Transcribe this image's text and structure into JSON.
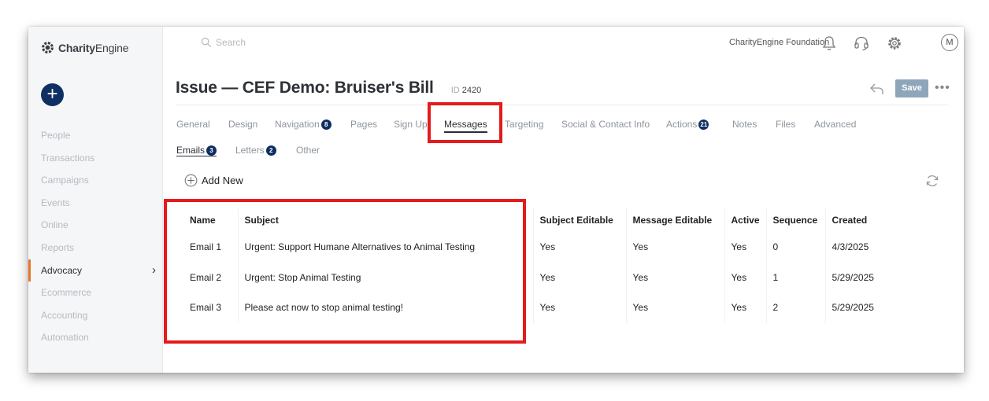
{
  "app": {
    "logo_bold": "Charity",
    "logo_rest": "Engine"
  },
  "sidebar": {
    "add_label": "+",
    "items": [
      {
        "label": "People"
      },
      {
        "label": "Transactions"
      },
      {
        "label": "Campaigns"
      },
      {
        "label": "Events"
      },
      {
        "label": "Online"
      },
      {
        "label": "Reports"
      },
      {
        "label": "Advocacy",
        "active": true
      },
      {
        "label": "Ecommerce"
      },
      {
        "label": "Accounting"
      },
      {
        "label": "Automation"
      }
    ],
    "chevron": "›"
  },
  "topbar": {
    "search_placeholder": "Search",
    "org_name": "CharityEngine Foundation",
    "avatar_initial": "M"
  },
  "page": {
    "title": "Issue — CEF Demo: Bruiser's Bill",
    "id_label": "ID",
    "id_value": "2420",
    "save_label": "Save",
    "more_label": "•••"
  },
  "tabs": [
    {
      "label": "General"
    },
    {
      "label": "Design"
    },
    {
      "label": "Navigation",
      "badge": "8"
    },
    {
      "label": "Pages"
    },
    {
      "label": "Sign Up"
    },
    {
      "label": "Messages",
      "active": true
    },
    {
      "label": "Targeting"
    },
    {
      "label": "Social & Contact Info"
    },
    {
      "label": "Actions",
      "badge": "21"
    },
    {
      "label": "Notes"
    },
    {
      "label": "Files"
    },
    {
      "label": "Advanced"
    }
  ],
  "subtabs": [
    {
      "label": "Emails",
      "badge": "3",
      "active": true
    },
    {
      "label": "Letters",
      "badge": "2"
    },
    {
      "label": "Other"
    }
  ],
  "actions": {
    "add_new_label": "Add New"
  },
  "table": {
    "columns": [
      "Name",
      "Subject",
      "Subject Editable",
      "Message Editable",
      "Active",
      "Sequence",
      "Created"
    ],
    "rows": [
      [
        "Email 1",
        "Urgent: Support Humane Alternatives to Animal Testing",
        "Yes",
        "Yes",
        "Yes",
        "0",
        "4/3/2025"
      ],
      [
        "Email 2",
        "Urgent: Stop Animal Testing",
        "Yes",
        "Yes",
        "Yes",
        "1",
        "5/29/2025"
      ],
      [
        "Email 3",
        "Please act now to stop animal testing!",
        "Yes",
        "Yes",
        "Yes",
        "2",
        "5/29/2025"
      ]
    ]
  },
  "colors": {
    "accent": "#0e2f63",
    "highlight": "#e51b1b",
    "active_nav": "#e8762b",
    "link": "#1d5fa0"
  },
  "icons": [
    "gear-logo-icon",
    "search-icon",
    "bell-icon",
    "headset-icon",
    "gear-icon",
    "back-arrow-icon",
    "plus-circle-icon",
    "refresh-icon"
  ]
}
